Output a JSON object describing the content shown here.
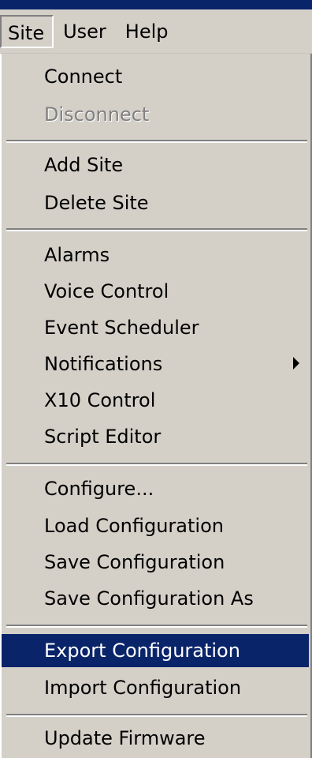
{
  "menubar": {
    "site": "Site",
    "user": "User",
    "help": "Help"
  },
  "site_menu": {
    "connect": "Connect",
    "disconnect": "Disconnect",
    "add_site": "Add Site",
    "delete_site": "Delete Site",
    "alarms": "Alarms",
    "voice_control": "Voice Control",
    "event_scheduler": "Event Scheduler",
    "notifications": "Notifications",
    "x10_control": "X10 Control",
    "script_editor": "Script Editor",
    "configure": "Configure...",
    "load_configuration": "Load Configuration",
    "save_configuration": "Save Configuration",
    "save_configuration_as": "Save Configuration As",
    "export_configuration": "Export Configuration",
    "import_configuration": "Import Configuration",
    "update_firmware": "Update Firmware",
    "selected_item": "Export Configuration",
    "submenu_arrow_icon": "submenu-arrow-icon"
  },
  "colors": {
    "menu_background": "#d4d0c8",
    "highlight": "#0a246a",
    "disabled_text": "#808080"
  }
}
